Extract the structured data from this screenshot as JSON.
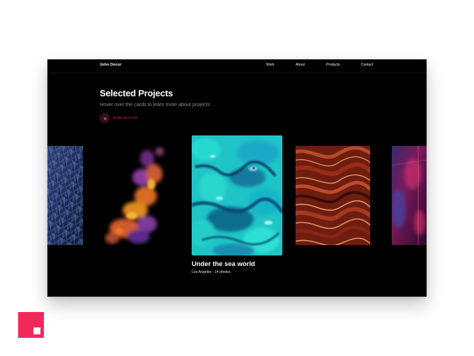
{
  "site": {
    "brand": "John Decor"
  },
  "nav": {
    "items": [
      {
        "label": "Work"
      },
      {
        "label": "About"
      },
      {
        "label": "Products"
      },
      {
        "label": "Contact"
      }
    ]
  },
  "hero": {
    "title": "Selected Projects",
    "subtitle": "Hover over the cards to learn more about projects"
  },
  "toggle": {
    "label": "Enable light mode",
    "accent": "#e5265a"
  },
  "active_card": {
    "title": "Under the sea world",
    "meta": "Los Angeles - 14 photos"
  },
  "cards": [
    {
      "image": "blue-geometric-facade"
    },
    {
      "image": "orange-purple-ink-smoke"
    },
    {
      "image": "turquoise-ocean-aerial"
    },
    {
      "image": "red-marble-swirl"
    },
    {
      "image": "neon-pink-corridor"
    }
  ],
  "colors": {
    "frame_bg": "#000000",
    "accent": "#f0295b",
    "text": "#ffffff",
    "muted": "#8d8d8d"
  },
  "logo": {
    "name": "square-logo-icon"
  }
}
